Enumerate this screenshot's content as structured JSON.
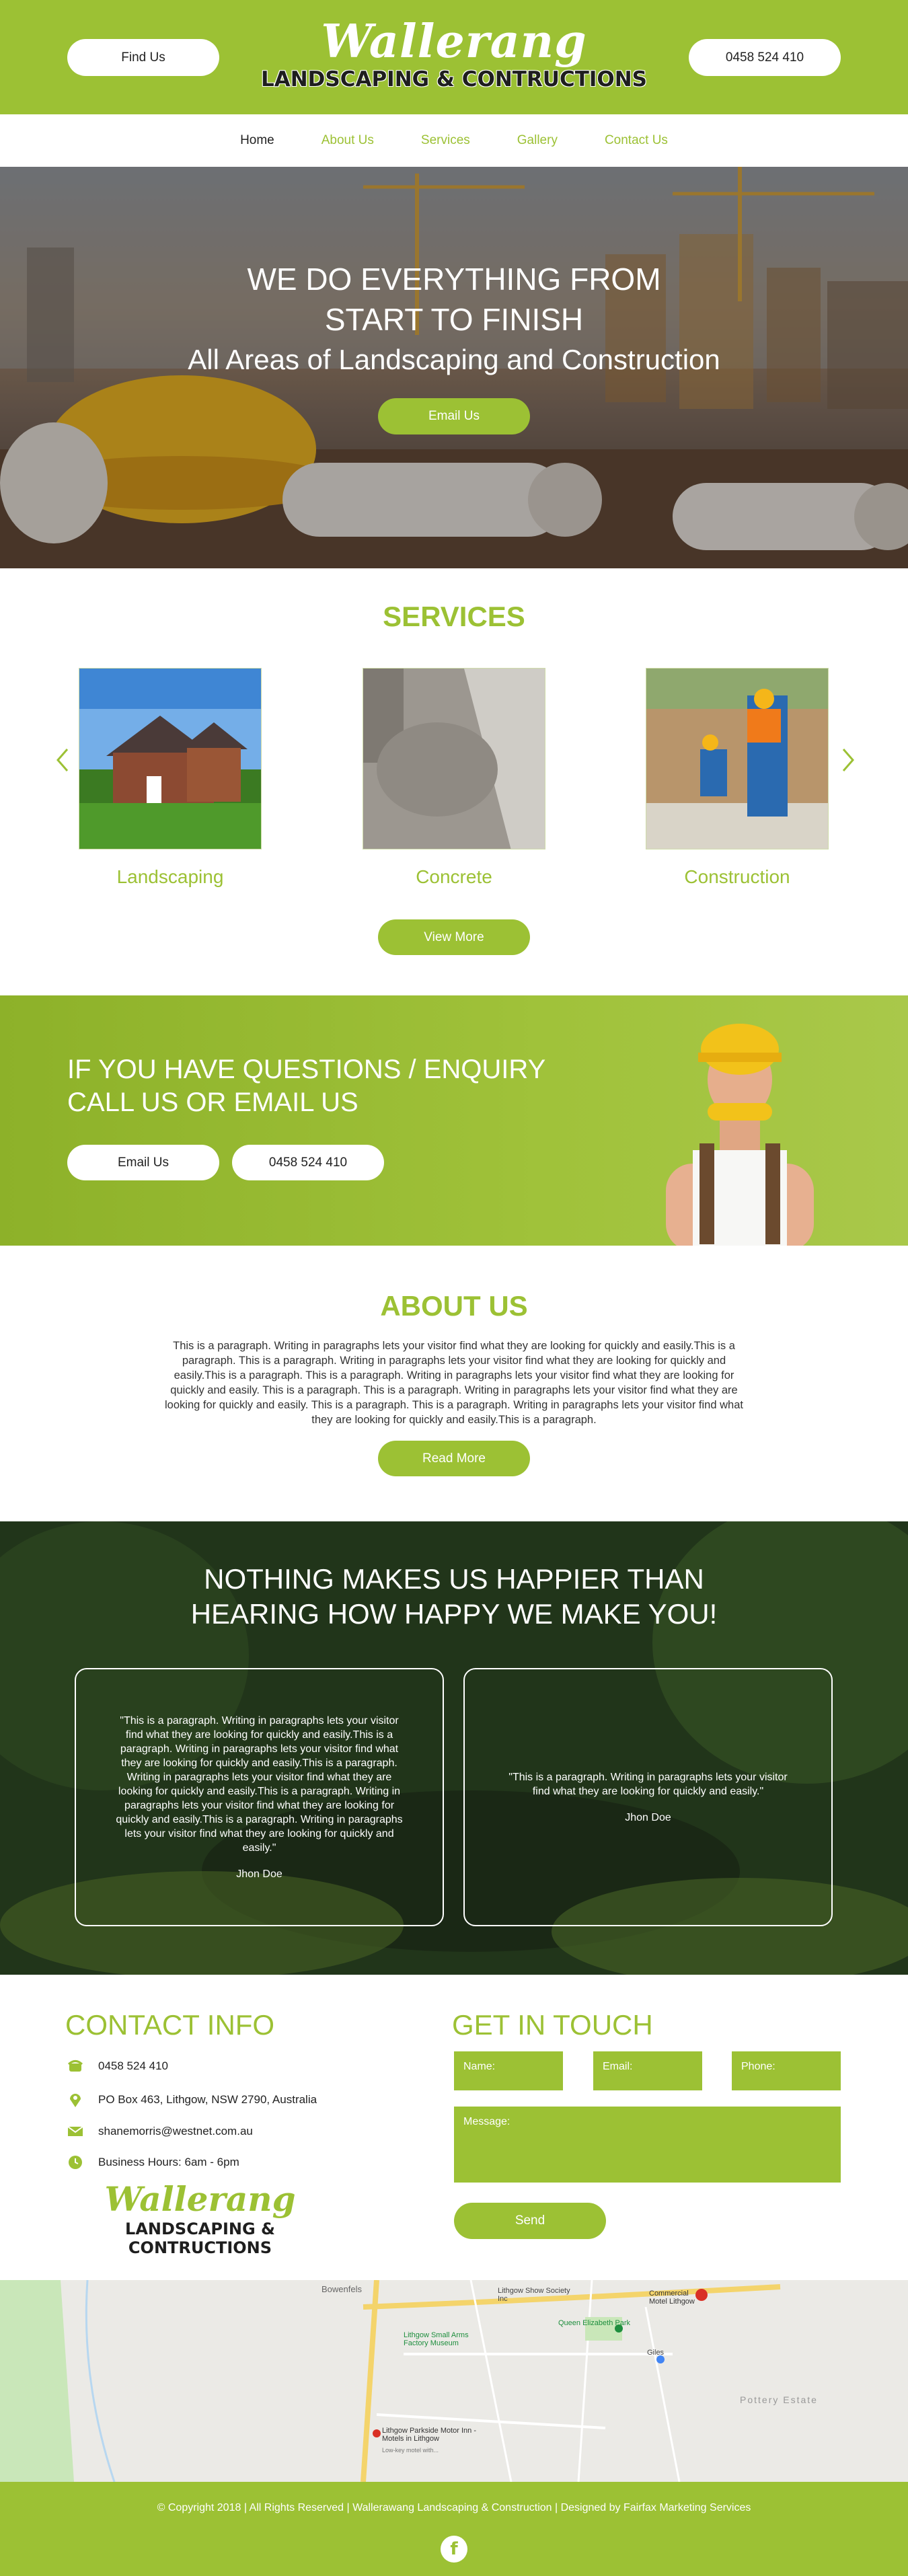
{
  "header": {
    "find_us": "Find Us",
    "phone": "0458 524 410",
    "logo_script": "Wallerang",
    "logo_sub": "LANDSCAPING & CONTRUCTIONS"
  },
  "nav": {
    "items": [
      "Home",
      "About Us",
      "Services",
      "Gallery",
      "Contact Us"
    ]
  },
  "hero": {
    "line1": "WE DO EVERYTHING FROM",
    "line2": "START TO FINISH",
    "line3": "All Areas of Landscaping and Construction",
    "button": "Email Us"
  },
  "services": {
    "title": "SERVICES",
    "items": [
      {
        "label": "Landscaping",
        "icon": "house-lawn-image"
      },
      {
        "label": "Concrete",
        "icon": "concrete-pour-image"
      },
      {
        "label": "Construction",
        "icon": "construction-workers-image"
      }
    ],
    "button": "View More"
  },
  "cta": {
    "line1": "IF YOU HAVE QUESTIONS / ENQUIRY",
    "line2": "CALL US OR  EMAIL US",
    "email_btn": "Email Us",
    "phone_btn": "0458 524 410"
  },
  "about": {
    "title": "ABOUT US",
    "paragraph": "This is a paragraph. Writing in paragraphs lets your visitor find what they are looking for quickly and easily.This is a paragraph. This is a paragraph. Writing in paragraphs lets your visitor find what they are looking for quickly and easily.This is a paragraph. This is a paragraph. Writing in paragraphs lets your visitor find what they are looking for quickly and easily. This is a paragraph. This is a paragraph. Writing in paragraphs lets your visitor find what they are looking for quickly and easily. This is a paragraph. This is a paragraph. Writing in paragraphs lets your visitor find what they are looking for quickly and easily.This is a paragraph.",
    "button": "Read More"
  },
  "testimonials": {
    "line1": "NOTHING MAKES US HAPPIER THAN",
    "line2": "HEARING HOW HAPPY WE MAKE YOU!",
    "cards": [
      {
        "quote": "\"This is a paragraph. Writing in paragraphs lets your visitor find what they are looking for quickly and easily.This is a paragraph. Writing in paragraphs lets your visitor find what they are looking for quickly and easily.This is a paragraph. Writing in paragraphs lets your visitor find what they are looking for quickly and easily.This is a paragraph. Writing in paragraphs lets your visitor find what they are looking for quickly and easily.This is a paragraph. Writing in paragraphs lets your visitor find what they are looking for quickly and easily.\"",
        "name": "Jhon Doe"
      },
      {
        "quote": "\"This is a paragraph. Writing in paragraphs lets your visitor find what they are looking for quickly and easily.\"",
        "name": "Jhon Doe"
      }
    ]
  },
  "contact": {
    "title": "CONTACT INFO",
    "phone": "0458 524 410",
    "address": "PO Box 463, Lithgow, NSW 2790, Australia",
    "email": "shanemorris@westnet.com.au",
    "hours": "Business Hours: 6am - 6pm",
    "logo_script": "Wallerang",
    "logo_sub": "LANDSCAPING & CONTRUCTIONS"
  },
  "form": {
    "title": "GET IN TOUCH",
    "name_ph": "Name:",
    "email_ph": "Email:",
    "phone_ph": "Phone:",
    "message_ph": "Message:",
    "send": "Send"
  },
  "map": {
    "labels": [
      "Bowenfels",
      "Lithgow Show Society Inc",
      "Commercial Motel Lithgow",
      "Queen Elizabeth Park",
      "Lithgow Small Arms Factory Museum",
      "Giles",
      "Pottery Estate",
      "Lithgow Parkside Motor Inn - Motels in Lithgow",
      "Low-key motel with..."
    ]
  },
  "footer": {
    "copyright": "© Copyright 2018 | All Rights Reserved | Wallerawang Landscaping & Construction | Designed by Fairfax Marketing Services",
    "fb": "f"
  }
}
